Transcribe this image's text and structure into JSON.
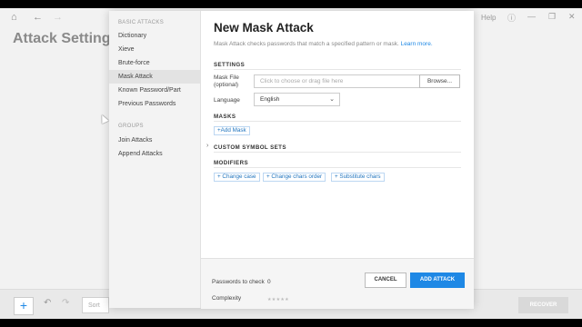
{
  "background": {
    "title": "Attack Settings",
    "help": "Help",
    "footer": {
      "sort": "Sort by F",
      "recover": "RECOVER"
    }
  },
  "sidebar": {
    "basic_heading": "BASIC ATTACKS",
    "basic_items": [
      {
        "label": "Dictionary"
      },
      {
        "label": "Xieve"
      },
      {
        "label": "Brute-force"
      },
      {
        "label": "Mask Attack"
      },
      {
        "label": "Known Password/Part"
      },
      {
        "label": "Previous Passwords"
      }
    ],
    "groups_heading": "GROUPS",
    "group_items": [
      {
        "label": "Join Attacks"
      },
      {
        "label": "Append Attacks"
      }
    ],
    "active": "Mask Attack"
  },
  "dialog": {
    "title": "New Mask Attack",
    "description": "Mask Attack checks passwords that match a specified pattern or mask.",
    "learn_more": "Learn more.",
    "settings_heading": "SETTINGS",
    "mask_file_label": "Mask File",
    "mask_file_sub": "(optional)",
    "file_placeholder": "Click to choose or drag file here",
    "browse_label": "Browse...",
    "language_label": "Language",
    "language_value": "English",
    "masks_heading": "MASKS",
    "add_mask": "+Add Mask",
    "custom_heading": "CUSTOM SYMBOL SETS",
    "modifiers_heading": "MODIFIERS",
    "modifiers": [
      {
        "label": "+ Change case"
      },
      {
        "label": "+ Change chars order"
      },
      {
        "label": "+ Substitute chars"
      }
    ],
    "passwords_label": "Passwords to check",
    "passwords_value": "0",
    "complexity_label": "Complexity",
    "complexity_stars": "★★★★★",
    "cancel": "CANCEL",
    "add_attack": "ADD ATTACK"
  },
  "colors": {
    "accent": "#1e88e5",
    "sidebar_bg": "#f3f3f3",
    "active_bg": "#e3e3e3"
  }
}
